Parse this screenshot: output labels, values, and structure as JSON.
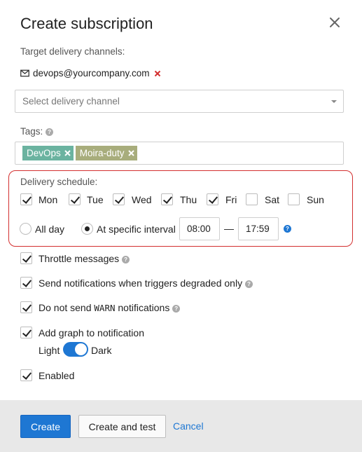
{
  "dialog": {
    "title": "Create subscription"
  },
  "channels": {
    "label": "Target delivery channels:",
    "email": "devops@yourcompany.com",
    "select_placeholder": "Select delivery channel"
  },
  "tags": {
    "label": "Tags:",
    "items": [
      {
        "label": "DevOps",
        "color": "#6bb3a0"
      },
      {
        "label": "Moira-duty",
        "color": "#a8ad7c"
      }
    ]
  },
  "schedule": {
    "label": "Delivery schedule:",
    "days": [
      {
        "label": "Mon",
        "checked": true
      },
      {
        "label": "Tue",
        "checked": true
      },
      {
        "label": "Wed",
        "checked": true
      },
      {
        "label": "Thu",
        "checked": true
      },
      {
        "label": "Fri",
        "checked": true
      },
      {
        "label": "Sat",
        "checked": false
      },
      {
        "label": "Sun",
        "checked": false
      }
    ],
    "all_day_label": "All day",
    "specific_label": "At specific interval",
    "start_time": "08:00",
    "separator": "—",
    "end_time": "17:59"
  },
  "options": {
    "throttle": "Throttle messages",
    "degraded": "Send notifications when triggers degraded only",
    "warn_prefix": "Do not send",
    "warn_code": "WARN",
    "warn_suffix": "notifications",
    "graph": "Add graph to notification",
    "theme_light": "Light",
    "theme_dark": "Dark",
    "enabled": "Enabled"
  },
  "footer": {
    "create": "Create",
    "create_test": "Create and test",
    "cancel": "Cancel"
  },
  "colors": {
    "accent": "#1e77d3",
    "error": "#d32f2f"
  }
}
